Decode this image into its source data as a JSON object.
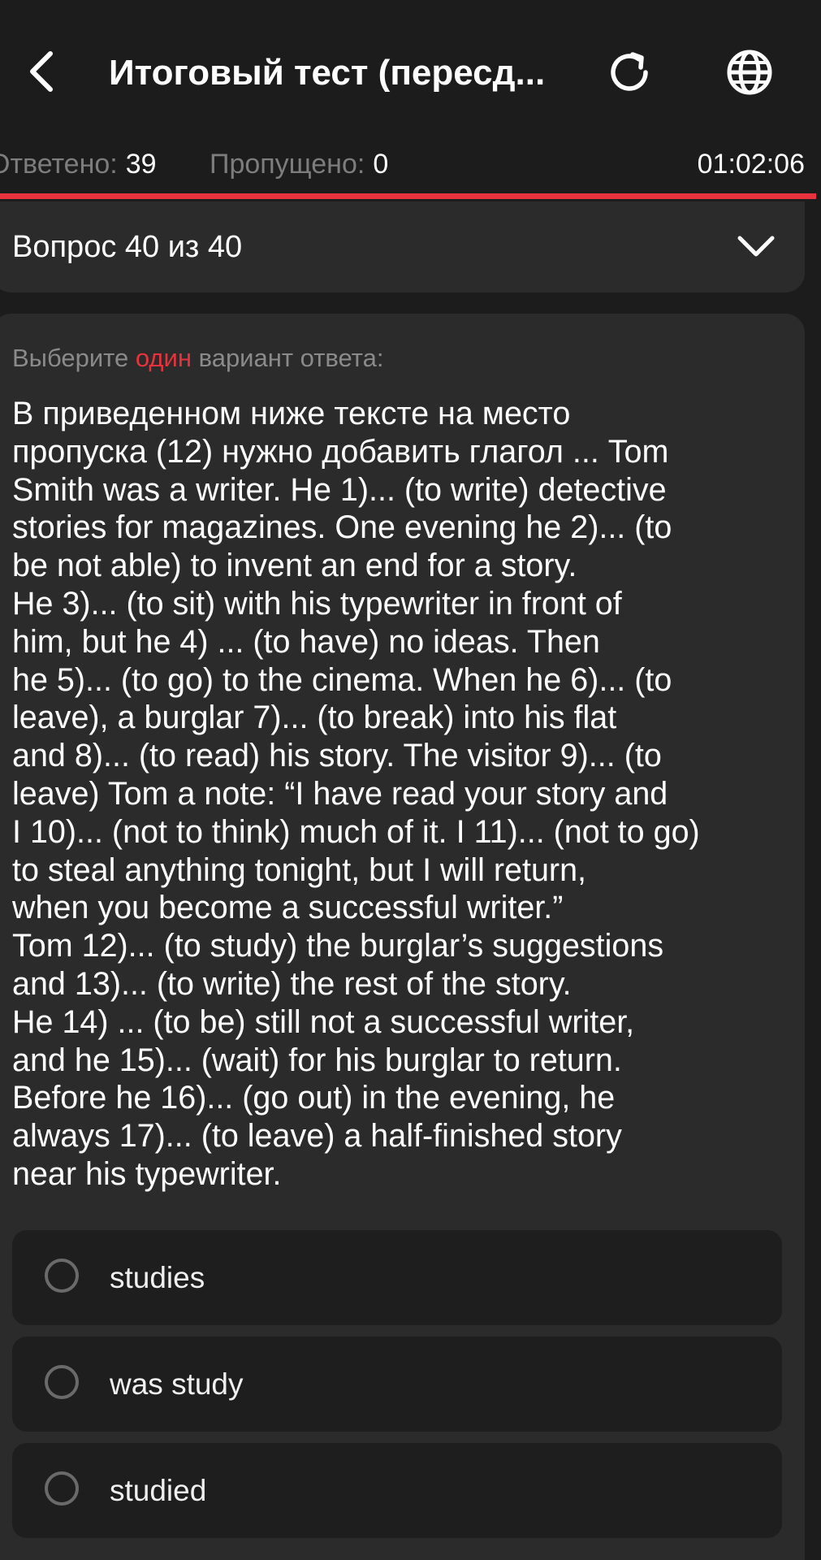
{
  "header": {
    "title": "Итоговый тест (пересд...",
    "back_icon": "chevron-left-icon",
    "refresh_icon": "refresh-icon",
    "language_icon": "globe-icon"
  },
  "stats": {
    "answered_label": "Ответено:",
    "answered_value": "39",
    "skipped_label": "Пропущено:",
    "skipped_value": "0",
    "timer": "01:02:06",
    "progress_fraction": 1.0
  },
  "question_selector": {
    "label": "Вопрос 40 из 40",
    "icon": "chevron-down-icon"
  },
  "question": {
    "instruction_before": "Выберите ",
    "instruction_accent": "один",
    "instruction_after": " вариант ответа:",
    "lines": [
      "В приведенном ниже тексте на место",
      "пропуска (12) нужно добавить глагол ... Tom",
      "Smith was a writer. He 1)... (to write) detective",
      "stories for magazines. One evening he 2)... (to",
      "be not able) to invent an end for a story.",
      "He 3)... (to sit) with his typewriter in front of",
      "him, but he 4) ... (to have) no ideas. Then",
      "he 5)... (to go) to the cinema. When he 6)... (to",
      "leave), a burglar 7)... (to break) into his flat",
      "and 8)... (to read) his story. The visitor 9)... (to",
      "leave) Tom a note: “I have read your story and",
      "I 10)... (not to think) much of it. I 11)... (not to go)",
      "to steal anything tonight, but I will return,",
      "when you become a successful writer.”",
      "Tom 12)... (to study) the burglar’s suggestions",
      "and 13)... (to write) the rest of the story.",
      "He 14) ... (to be) still not a successful writer,",
      "and he 15)... (wait) for his burglar to return.",
      "Before he 16)... (go out) in the evening, he",
      "always 17)... (to leave) a half-finished story",
      "near his typewriter."
    ]
  },
  "options": [
    {
      "label": "studies"
    },
    {
      "label": "was study"
    },
    {
      "label": "studied"
    }
  ],
  "colors": {
    "background": "#1c1c1c",
    "card": "#2b2b2b",
    "option_bg": "#1e1e1e",
    "accent": "#e8323d",
    "muted_text": "#8a8a8a"
  }
}
